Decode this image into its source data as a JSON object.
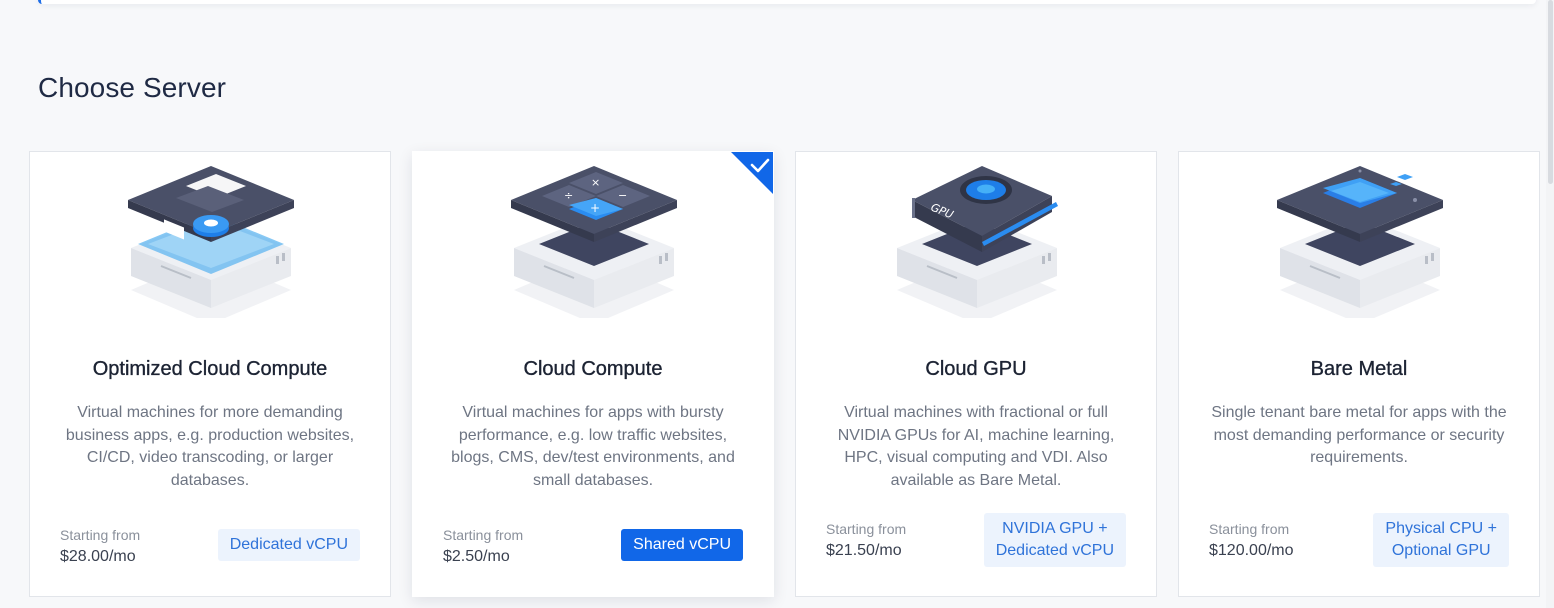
{
  "section": {
    "title": "Choose Server"
  },
  "colors": {
    "accent": "#1167e8",
    "tag_bg": "#ecf3fd",
    "tag_text": "#2f73d9"
  },
  "cards": [
    {
      "title": "Optimized Cloud Compute",
      "description": "Virtual machines for more demanding business apps, e.g. production websites, CI/CD, video transcoding, or larger databases.",
      "price_label": "Starting from",
      "price": "$28.00/mo",
      "tag_line1": "Dedicated vCPU",
      "tag_line2": "",
      "selected": false,
      "icon": "optimized-server-icon"
    },
    {
      "title": "Cloud Compute",
      "description": "Virtual machines for apps with bursty performance, e.g. low traffic websites, blogs, CMS, dev/test environments, and small databases.",
      "price_label": "Starting from",
      "price": "$2.50/mo",
      "tag_line1": "Shared vCPU",
      "tag_line2": "",
      "selected": true,
      "icon": "calculator-server-icon"
    },
    {
      "title": "Cloud GPU",
      "description": "Virtual machines with fractional or full NVIDIA GPUs for AI, machine learning, HPC, visual computing and VDI. Also available as Bare Metal.",
      "price_label": "Starting from",
      "price": "$21.50/mo",
      "tag_line1": "NVIDIA GPU +",
      "tag_line2": "Dedicated vCPU",
      "selected": false,
      "icon": "gpu-server-icon",
      "gpu_label": "GPU"
    },
    {
      "title": "Bare Metal",
      "description": "Single tenant bare metal for apps with the most demanding performance or security requirements.",
      "price_label": "Starting from",
      "price": "$120.00/mo",
      "tag_line1": "Physical CPU +",
      "tag_line2": "Optional GPU",
      "selected": false,
      "icon": "bare-metal-server-icon"
    }
  ]
}
